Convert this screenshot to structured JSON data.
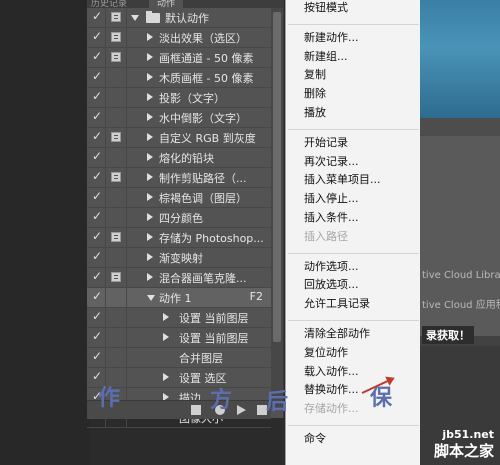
{
  "panel": {
    "tabs": [
      "历史记录",
      "动作"
    ],
    "rows": [
      {
        "check": true,
        "dialog": true,
        "expand": "down",
        "folder": true,
        "label": "默认动作",
        "shortcut": ""
      },
      {
        "check": true,
        "dialog": true,
        "expand": "right",
        "folder": false,
        "label": "淡出效果（选区）",
        "shortcut": ""
      },
      {
        "check": true,
        "dialog": true,
        "expand": "right",
        "folder": false,
        "label": "画框通道 - 50 像素",
        "shortcut": ""
      },
      {
        "check": true,
        "dialog": false,
        "expand": "right",
        "folder": false,
        "label": "木质画框 - 50 像素",
        "shortcut": ""
      },
      {
        "check": true,
        "dialog": false,
        "expand": "right",
        "folder": false,
        "label": "投影（文字）",
        "shortcut": ""
      },
      {
        "check": true,
        "dialog": false,
        "expand": "right",
        "folder": false,
        "label": "水中倒影（文字）",
        "shortcut": ""
      },
      {
        "check": true,
        "dialog": true,
        "expand": "right",
        "folder": false,
        "label": "自定义 RGB 到灰度",
        "shortcut": ""
      },
      {
        "check": true,
        "dialog": false,
        "expand": "right",
        "folder": false,
        "label": "熔化的铅块",
        "shortcut": ""
      },
      {
        "check": true,
        "dialog": true,
        "expand": "right",
        "folder": false,
        "label": "制作剪贴路径（...",
        "shortcut": ""
      },
      {
        "check": true,
        "dialog": false,
        "expand": "right",
        "folder": false,
        "label": "棕褐色调（图层）",
        "shortcut": ""
      },
      {
        "check": true,
        "dialog": false,
        "expand": "right",
        "folder": false,
        "label": "四分颜色",
        "shortcut": ""
      },
      {
        "check": true,
        "dialog": true,
        "expand": "right",
        "folder": false,
        "label": "存储为 Photoshop...",
        "shortcut": ""
      },
      {
        "check": true,
        "dialog": false,
        "expand": "right",
        "folder": false,
        "label": "渐变映射",
        "shortcut": ""
      },
      {
        "check": true,
        "dialog": true,
        "expand": "right",
        "folder": false,
        "label": "混合器画笔克隆...",
        "shortcut": ""
      },
      {
        "check": true,
        "dialog": false,
        "expand": "down",
        "folder": false,
        "label": "动作 1",
        "shortcut": "F2",
        "selected": true
      },
      {
        "check": true,
        "dialog": false,
        "expand": "right",
        "folder": false,
        "label": "设置 当前图层",
        "shortcut": "",
        "indent": 2
      },
      {
        "check": true,
        "dialog": false,
        "expand": "right",
        "folder": false,
        "label": "设置 当前图层",
        "shortcut": "",
        "indent": 2
      },
      {
        "check": true,
        "dialog": false,
        "expand": "none",
        "folder": false,
        "label": "合并图层",
        "shortcut": "",
        "indent": 2
      },
      {
        "check": true,
        "dialog": false,
        "expand": "right",
        "folder": false,
        "label": "设置 选区",
        "shortcut": "",
        "indent": 2
      },
      {
        "check": true,
        "dialog": false,
        "expand": "right",
        "folder": false,
        "label": "描边",
        "shortcut": "",
        "indent": 2
      },
      {
        "check": true,
        "dialog": false,
        "expand": "none",
        "folder": false,
        "label": "图像大小",
        "shortcut": "",
        "indent": 2
      }
    ]
  },
  "menu": {
    "items": [
      {
        "label": "按钮模式",
        "disabled": false
      },
      {
        "sep": true
      },
      {
        "label": "新建动作...",
        "disabled": false
      },
      {
        "label": "新建组...",
        "disabled": false
      },
      {
        "label": "复制",
        "disabled": false
      },
      {
        "label": "删除",
        "disabled": false
      },
      {
        "label": "播放",
        "disabled": false
      },
      {
        "sep": true
      },
      {
        "label": "开始记录",
        "disabled": false
      },
      {
        "label": "再次记录...",
        "disabled": false
      },
      {
        "label": "插入菜单项目...",
        "disabled": false
      },
      {
        "label": "插入停止...",
        "disabled": false
      },
      {
        "label": "插入条件...",
        "disabled": false
      },
      {
        "label": "插入路径",
        "disabled": true
      },
      {
        "sep": true
      },
      {
        "label": "动作选项...",
        "disabled": false
      },
      {
        "label": "回放选项...",
        "disabled": false
      },
      {
        "label": "允许工具记录",
        "disabled": false
      },
      {
        "sep": true
      },
      {
        "label": "清除全部动作",
        "disabled": false
      },
      {
        "label": "复位动作",
        "disabled": false
      },
      {
        "label": "载入动作...",
        "disabled": false
      },
      {
        "label": "替换动作...",
        "disabled": false
      },
      {
        "label": "存储动作...",
        "disabled": true
      },
      {
        "sep": true
      },
      {
        "label": "命令",
        "disabled": false
      }
    ]
  },
  "right": {
    "cc_line1": "tive Cloud Library",
    "cc_line2": "tive Cloud 应用程",
    "login": "录获取！",
    "site1": "jb51.net",
    "site2": "脚本之家"
  },
  "overlay": {
    "chars": [
      "作",
      "方",
      "后",
      "保"
    ],
    "color": "#5b6fb0"
  }
}
